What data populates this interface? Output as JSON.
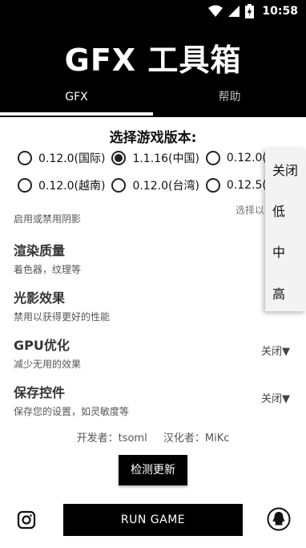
{
  "status_bar": {
    "time": "10:58",
    "icons": [
      "wifi-icon",
      "signal-icon",
      "battery-icon"
    ]
  },
  "app": {
    "title": "GFX 工具箱"
  },
  "tabs": [
    {
      "label": "GFX"
    },
    {
      "label": "帮助"
    }
  ],
  "version": {
    "title": "选择游戏版本:",
    "row1": [
      "0.12.0(国际)",
      "1.1.16(中国)",
      "0.12.0("
    ],
    "row2": [
      "0.12.0(越南)",
      "0.12.0(台湾)",
      "0.12.5("
    ],
    "selected": "1.1.16(中国)"
  },
  "partial": {
    "left": "启用或禁用阴影",
    "right": "选择以"
  },
  "settings": [
    {
      "title": "渲染质量",
      "desc": "着色器，纹理等"
    },
    {
      "title": "光影效果",
      "desc": "禁用以获得更好的性能"
    },
    {
      "title": "GPU优化",
      "desc": "减少无用的效果",
      "value": "关闭"
    },
    {
      "title": "保存控件",
      "desc": "保存您的设置，如灵敏度等",
      "value": "关闭"
    }
  ],
  "credits": {
    "developer": "开发者：tsoml",
    "translator": "汉化者：MiKc"
  },
  "buttons": {
    "update": "检测更新",
    "run": "RUN GAME"
  },
  "popup_menu": [
    "关闭",
    "低",
    "中",
    "高"
  ],
  "icons": {
    "left_footer": "instagram-icon",
    "right_footer": "qq-icon"
  }
}
